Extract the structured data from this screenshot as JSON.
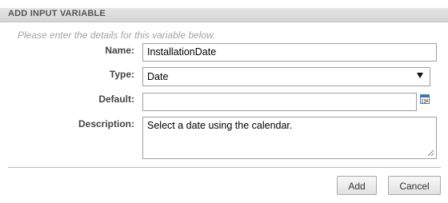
{
  "dialog": {
    "title": "ADD INPUT VARIABLE",
    "hint": "Please enter the details for this variable below."
  },
  "form": {
    "name_label": "Name:",
    "name_value": "InstallationDate",
    "type_label": "Type:",
    "type_value": "Date",
    "default_label": "Default:",
    "default_value": "",
    "description_label": "Description:",
    "description_value": "Select a date using the calendar."
  },
  "buttons": {
    "add": "Add",
    "cancel": "Cancel"
  },
  "icons": {
    "calendar": "calendar-icon",
    "dropdown": "chevron-down-icon",
    "resize": "resize-grip-icon"
  }
}
